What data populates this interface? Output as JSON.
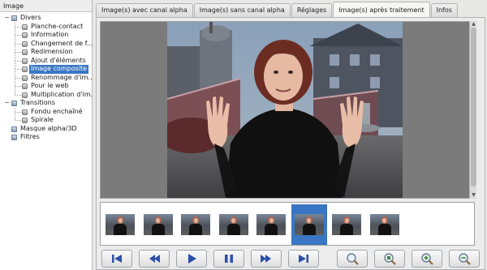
{
  "tree": {
    "header": "Image",
    "items": [
      {
        "label": "Divers",
        "level": 0,
        "type": "folder",
        "expanded": true
      },
      {
        "label": "Planche-contact",
        "level": 1,
        "type": "leaf"
      },
      {
        "label": "Information",
        "level": 1,
        "type": "leaf"
      },
      {
        "label": "Changement de f...",
        "level": 1,
        "type": "leaf"
      },
      {
        "label": "Redimension",
        "level": 1,
        "type": "leaf"
      },
      {
        "label": "Ajout d'éléments",
        "level": 1,
        "type": "leaf"
      },
      {
        "label": "Image composite",
        "level": 1,
        "type": "leaf",
        "selected": true
      },
      {
        "label": "Renommage d'im...",
        "level": 1,
        "type": "leaf"
      },
      {
        "label": "Pour le web",
        "level": 1,
        "type": "leaf"
      },
      {
        "label": "Multiplication d'im...",
        "level": 1,
        "type": "leaf"
      },
      {
        "label": "Transitions",
        "level": 0,
        "type": "folder",
        "expanded": true
      },
      {
        "label": "Fondu enchaîné",
        "level": 1,
        "type": "leaf"
      },
      {
        "label": "Spirale",
        "level": 1,
        "type": "leaf"
      },
      {
        "label": "Masque alpha/3D",
        "level": 0,
        "type": "folder"
      },
      {
        "label": "Filtres",
        "level": 0,
        "type": "folder"
      }
    ]
  },
  "tabs": [
    {
      "label": "Image(s) avec canal alpha"
    },
    {
      "label": "Image(s) sans canal alpha"
    },
    {
      "label": "Réglages"
    },
    {
      "label": "Image(s) après traitement",
      "active": true
    },
    {
      "label": "Infos"
    }
  ],
  "filmstrip": {
    "count": 8,
    "selected_index": 5
  },
  "controls": [
    {
      "name": "first-button",
      "icon": "skip-to-start-icon"
    },
    {
      "name": "rewind-button",
      "icon": "rewind-icon"
    },
    {
      "name": "play-button",
      "icon": "play-icon"
    },
    {
      "name": "pause-button",
      "icon": "pause-icon"
    },
    {
      "name": "fast-forward-button",
      "icon": "fast-forward-icon"
    },
    {
      "name": "last-button",
      "icon": "skip-to-end-icon"
    },
    {
      "name": "zoom-fit-button",
      "icon": "zoom-fit-icon"
    },
    {
      "name": "zoom-original-button",
      "icon": "zoom-original-icon"
    },
    {
      "name": "zoom-in-button",
      "icon": "zoom-in-icon"
    },
    {
      "name": "zoom-out-button",
      "icon": "zoom-out-icon"
    }
  ],
  "colors": {
    "selection": "#3a76c4",
    "button_icon": "#2b4fa8"
  }
}
